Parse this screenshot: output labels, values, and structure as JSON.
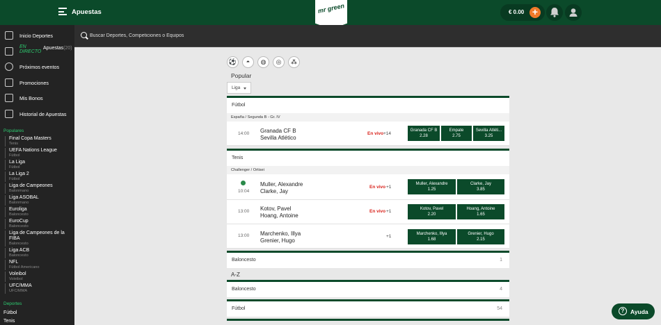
{
  "header": {
    "title": "Apuestas",
    "logo_text": "mr green",
    "balance": "€ 0.00",
    "deposit_symbol": "+"
  },
  "search": {
    "placeholder": "Buscar Deportes, Competiciones o Equipos"
  },
  "sidebar": {
    "nav": [
      {
        "label": "Inicio Deportes",
        "icon": "grid-icon"
      },
      {
        "live_label": "EN DIRECTO",
        "label": "Apuestas",
        "count": "(20)",
        "icon": "tv-icon"
      },
      {
        "label": "Próximos eventos",
        "icon": "clock-icon"
      },
      {
        "label": "Promociones",
        "icon": "gift-icon"
      },
      {
        "label": "Mis Bonos",
        "icon": "money-icon"
      },
      {
        "label": "Historial de Apuestas",
        "icon": "document-icon"
      }
    ],
    "populares_title": "Populares",
    "populares": [
      {
        "name": "Final Copa Masters",
        "sport": "Tenis"
      },
      {
        "name": "UEFA Nations League",
        "sport": "Fútbol"
      },
      {
        "name": "La Liga",
        "sport": "Fútbol"
      },
      {
        "name": "La Liga 2",
        "sport": "Fútbol"
      },
      {
        "name": "Liga de Campeones",
        "sport": "Balonmano"
      },
      {
        "name": "Liga ASOBAL",
        "sport": "Balonmano"
      },
      {
        "name": "Euroliga",
        "sport": "Baloncesto"
      },
      {
        "name": "EuroCup",
        "sport": "Baloncesto"
      },
      {
        "name": "Liga de Campeones de la FIBA",
        "sport": "Baloncesto"
      },
      {
        "name": "Liga ACB",
        "sport": "Baloncesto"
      },
      {
        "name": "NFL",
        "sport": "Fútbol Americano"
      },
      {
        "name": "Voleibol",
        "sport": "Voleibol"
      },
      {
        "name": "UFC/MMA",
        "sport": "UFC/MMA"
      }
    ],
    "deportes_title": "Deportes",
    "deportes": [
      "Fútbol",
      "Tenis"
    ]
  },
  "main": {
    "sport_icons": [
      "soccer-ball-icon",
      "baseball-icon",
      "basketball-icon",
      "volleyball-icon",
      "more-sports-icon"
    ],
    "popular_title": "Popular",
    "filter_value": "Liga",
    "futbol": {
      "title": "Fútbol",
      "league": "España / Segunda B - Gr. IV",
      "match": {
        "time": "14:00",
        "home": "Granada CF B",
        "away": "Sevilla Atlético",
        "live": "En vivo",
        "more": "+14",
        "odds": [
          {
            "label": "Granada CF B",
            "value": "2.28"
          },
          {
            "label": "Empate",
            "value": "2.75"
          },
          {
            "label": "Sevilla Atléti...",
            "value": "3.25"
          }
        ]
      }
    },
    "tenis": {
      "title": "Tenis",
      "league": "Challenger / Ortisei",
      "matches": [
        {
          "time": "10:04",
          "home": "Muller, Alexandre",
          "away": "Clarke, Jay",
          "live": "En vivo",
          "more": "+1",
          "odds": [
            {
              "label": "Muller, Alexandre",
              "value": "1.25"
            },
            {
              "label": "Clarke, Jay",
              "value": "3.85"
            }
          ]
        },
        {
          "time": "13:00",
          "home": "Kotov, Pavel",
          "away": "Hoang, Antoine",
          "live": "En vivo",
          "more": "+1",
          "odds": [
            {
              "label": "Kotov, Pavel",
              "value": "2.20"
            },
            {
              "label": "Hoang, Antoine",
              "value": "1.65"
            }
          ]
        },
        {
          "time": "13:00",
          "home": "Marchenko, Illya",
          "away": "Grenier, Hugo",
          "live": "",
          "more": "+1",
          "odds": [
            {
              "label": "Marchenko, Illya",
              "value": "1.68"
            },
            {
              "label": "Grenier, Hugo",
              "value": "2.15"
            }
          ]
        }
      ]
    },
    "baloncesto": {
      "title": "Baloncesto",
      "count": "1"
    },
    "az_title": "A-Z",
    "az": [
      {
        "title": "Baloncesto",
        "count": "4"
      },
      {
        "title": "Fútbol",
        "count": "54"
      }
    ]
  },
  "help": {
    "label": "Ayuda",
    "icon_char": "?"
  },
  "colors": {
    "brand": "#0b4a2a",
    "live": "#d9231c",
    "deposit": "#f07a2a",
    "accent": "#2ecc71"
  }
}
